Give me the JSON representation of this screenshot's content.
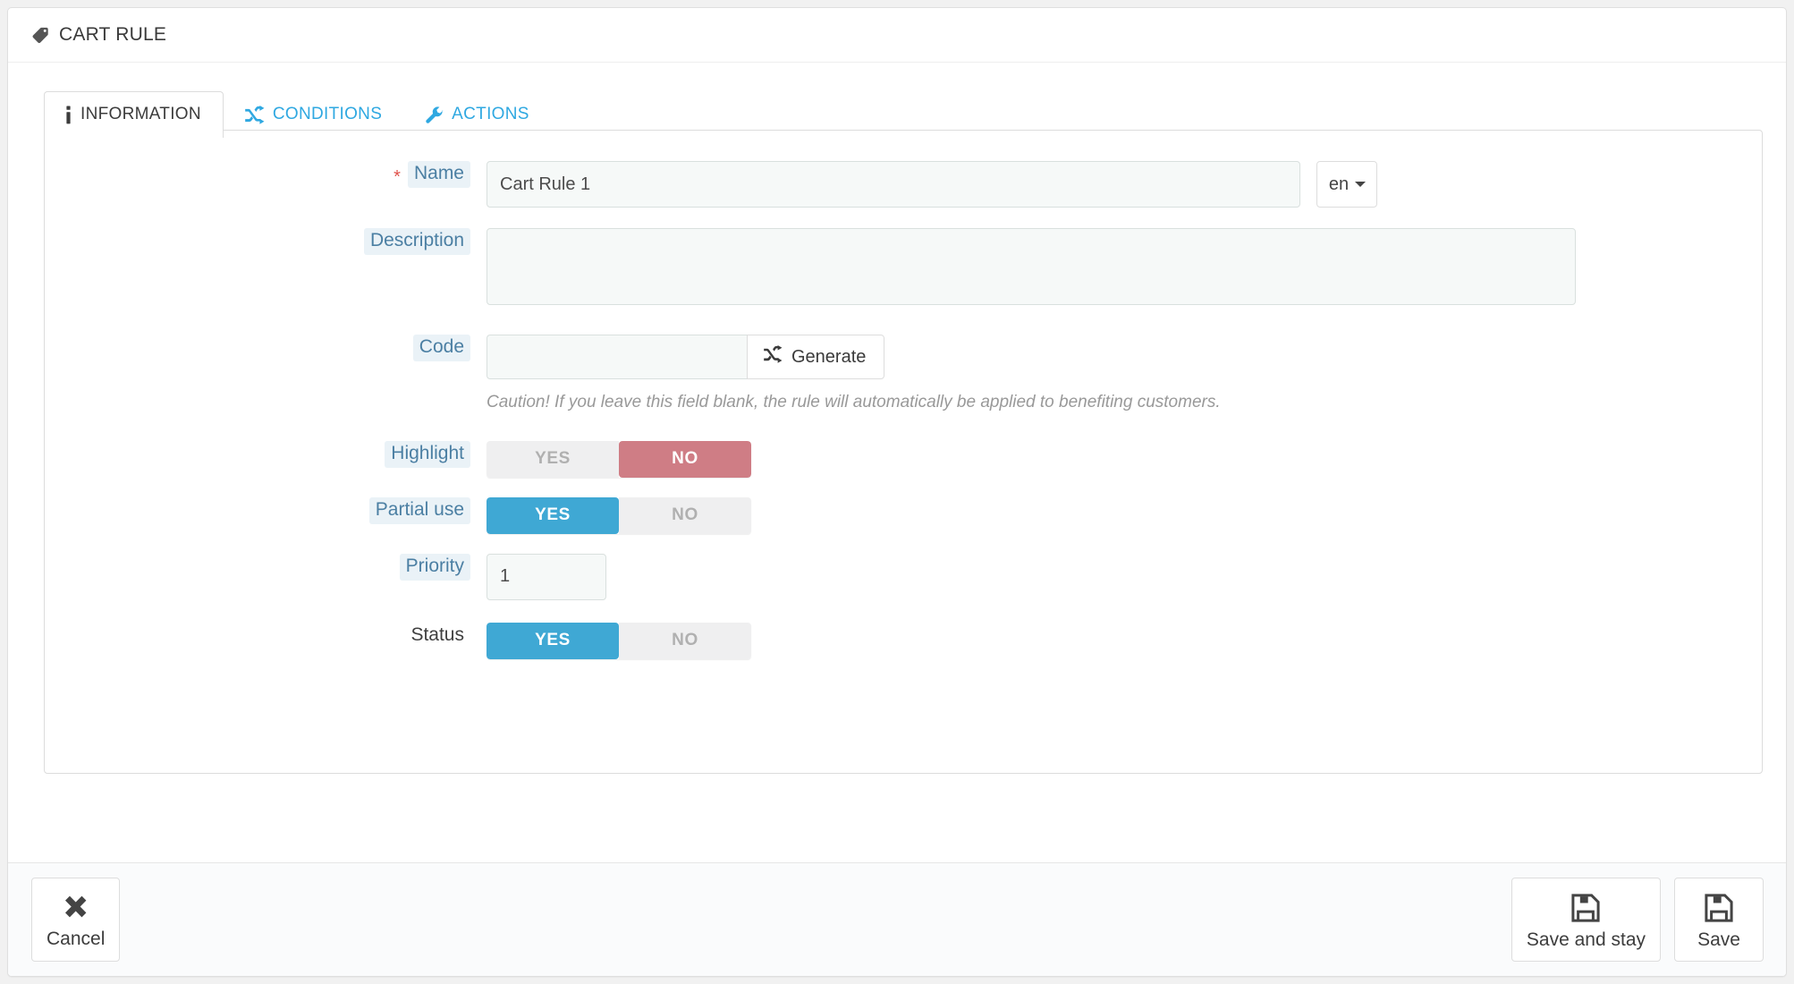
{
  "header": {
    "title": "CART RULE",
    "icon": "tag-icon"
  },
  "tabs": [
    {
      "label": "INFORMATION",
      "icon": "info-icon",
      "active": true
    },
    {
      "label": "CONDITIONS",
      "icon": "shuffle-icon",
      "active": false
    },
    {
      "label": "ACTIONS",
      "icon": "wrench-icon",
      "active": false
    }
  ],
  "form": {
    "name": {
      "label": "Name",
      "required_marker": "*",
      "value": "Cart Rule 1",
      "placeholder": ""
    },
    "language": {
      "selected": "en",
      "options": [
        "en"
      ]
    },
    "description": {
      "label": "Description",
      "value": "",
      "placeholder": ""
    },
    "code": {
      "label": "Code",
      "value": "",
      "placeholder": "",
      "generate_label": "Generate",
      "generate_icon": "shuffle-icon",
      "hint": "Caution! If you leave this field blank, the rule will automatically be applied to benefiting customers."
    },
    "highlight": {
      "label": "Highlight",
      "yes_label": "YES",
      "no_label": "NO",
      "value": "NO"
    },
    "partial_use": {
      "label": "Partial use",
      "yes_label": "YES",
      "no_label": "NO",
      "value": "YES"
    },
    "priority": {
      "label": "Priority",
      "value": "1",
      "placeholder": ""
    },
    "status": {
      "label": "Status",
      "yes_label": "YES",
      "no_label": "NO",
      "value": "YES"
    }
  },
  "footer": {
    "cancel": {
      "label": "Cancel",
      "icon": "close-x-icon"
    },
    "save_and_stay": {
      "label": "Save and stay",
      "icon": "floppy-disk-icon"
    },
    "save": {
      "label": "Save",
      "icon": "floppy-disk-icon"
    }
  },
  "colors": {
    "accent_blue": "#3fa8d4",
    "tab_link_blue": "#2fa8e1",
    "label_blue": "#4b7fa3",
    "label_bg": "#eaf2f7",
    "toggle_off": "#efeff0",
    "toggle_no_red": "#cf7d85",
    "required_red": "#e0524b",
    "panel_bg": "#ffffff",
    "footer_bg": "#fafbfc",
    "page_bg": "#f1f1f1"
  }
}
